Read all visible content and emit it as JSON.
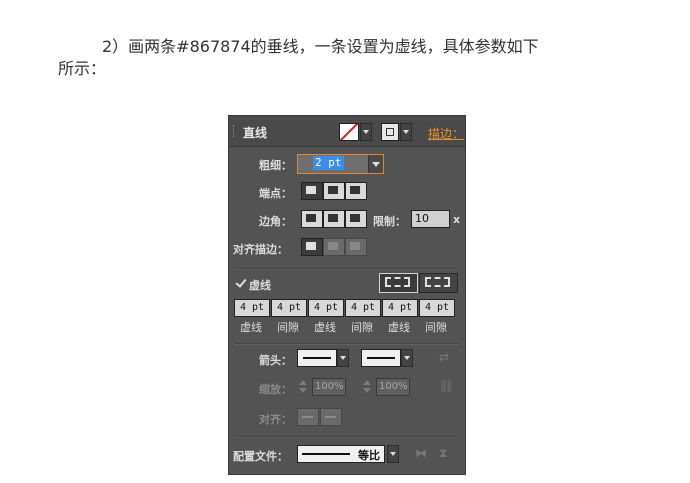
{
  "instruction": {
    "line1": "2）画两条#867874的垂线，一条设置为虚线，具体参数如下",
    "line2": "所示："
  },
  "panel": {
    "title": "直线",
    "stroke_link": "描边：",
    "weight": {
      "label": "粗细：",
      "value": "2 pt"
    },
    "cap": {
      "label": "端点："
    },
    "corner": {
      "label": "边角：",
      "limit_label": "限制：",
      "limit_value": "10",
      "limit_unit": "x"
    },
    "align_stroke": {
      "label": "对齐描边："
    },
    "dashed": {
      "label": "虚线",
      "checked": true,
      "fields": [
        {
          "value": "4 pt",
          "label": "虚线"
        },
        {
          "value": "4 pt",
          "label": "间隙"
        },
        {
          "value": "4 pt",
          "label": "虚线"
        },
        {
          "value": "4 pt",
          "label": "间隙"
        },
        {
          "value": "4 pt",
          "label": "虚线"
        },
        {
          "value": "4 pt",
          "label": "间隙"
        }
      ]
    },
    "arrowheads": {
      "label": "箭头："
    },
    "scale": {
      "label": "缩放：",
      "start": "100%",
      "end": "100%"
    },
    "align": {
      "label": "对齐："
    },
    "profile": {
      "label": "配置文件：",
      "value": "等比"
    }
  },
  "colors": {
    "panel_bg": "#535353",
    "accent_orange": "#e8902a",
    "selection_blue": "#3b8ee8",
    "stroke_swatch_slash": "#d42020"
  },
  "icons": {
    "swap": "swap-arrows-icon",
    "link": "link-chain-icon",
    "flip": "flip-icon"
  }
}
